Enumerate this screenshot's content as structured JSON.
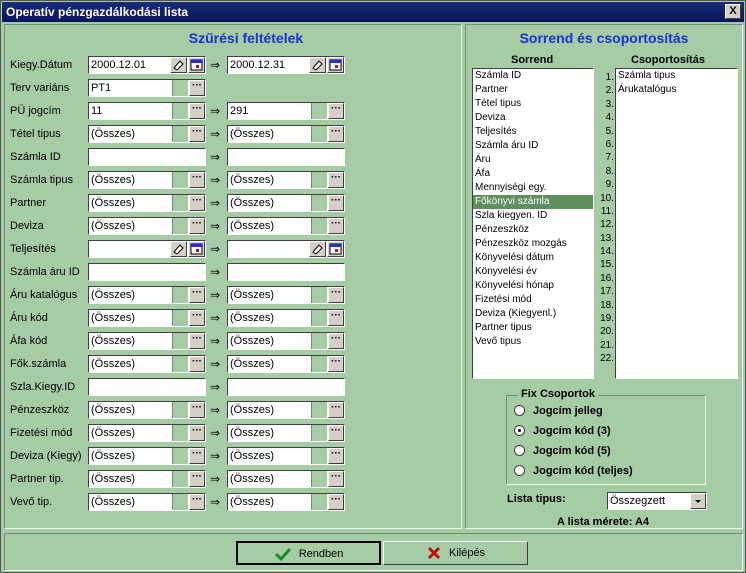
{
  "window": {
    "title": "Operatív pénzgazdálkodási lista",
    "close_label": "X"
  },
  "filters": {
    "heading": "Szűrési feltételek",
    "rows": [
      {
        "label": "Kiegy.Dátum",
        "from": "2000.12.01",
        "to": "2000.12.31"
      },
      {
        "label": "Terv variáns",
        "from": "PT1",
        "to": ""
      },
      {
        "label": "PÜ jogcím",
        "from": "11",
        "to": "291"
      },
      {
        "label": "Tétel tipus",
        "from": "(Összes)",
        "to": "(Összes)"
      },
      {
        "label": "Számla ID",
        "from": "",
        "to": ""
      },
      {
        "label": "Számla tipus",
        "from": "(Összes)",
        "to": "(Összes)"
      },
      {
        "label": "Partner",
        "from": "(Összes)",
        "to": "(Összes)"
      },
      {
        "label": "Deviza",
        "from": "(Összes)",
        "to": "(Összes)"
      },
      {
        "label": "Teljesítés",
        "from": "",
        "to": ""
      },
      {
        "label": "Számla áru ID",
        "from": "",
        "to": ""
      },
      {
        "label": "Áru katalógus",
        "from": "(Összes)",
        "to": "(Összes)"
      },
      {
        "label": "Áru kód",
        "from": "(Összes)",
        "to": "(Összes)"
      },
      {
        "label": "Áfa kód",
        "from": "(Összes)",
        "to": "(Összes)"
      },
      {
        "label": "Fők.számla",
        "from": "(Összes)",
        "to": "(Összes)"
      },
      {
        "label": "Szla.Kiegy.ID",
        "from": "",
        "to": ""
      },
      {
        "label": "Pénzeszköz",
        "from": "(Összes)",
        "to": "(Összes)"
      },
      {
        "label": "Fizetési mód",
        "from": "(Összes)",
        "to": "(Összes)"
      },
      {
        "label": "Deviza (Kiegy)",
        "from": "(Összes)",
        "to": "(Összes)"
      },
      {
        "label": "Partner tip.",
        "from": "(Összes)",
        "to": "(Összes)"
      },
      {
        "label": "Vevő tip.",
        "from": "(Összes)",
        "to": "(Összes)"
      }
    ],
    "arrow": "⇒",
    "dots": "···"
  },
  "sort": {
    "heading": "Sorrend és csoportosítás",
    "sort_title": "Sorrend",
    "group_title": "Csoportosítás",
    "sort_items": [
      "Számla ID",
      "Partner",
      "Tétel tipus",
      "Deviza",
      "Teljesítés",
      "Számla áru ID",
      "Áru",
      "Áfa",
      "Mennyiségi egy.",
      "Főkönyvi számla",
      "Szla kiegyen. ID",
      "Pénzeszköz",
      "Pénzeszköz mozgás",
      "Könyvelési dátum",
      "Könyvelési év",
      "Könyvelési hónap",
      "Fizetési mód",
      "Deviza (Kiegyenl.)",
      "Partner tipus",
      "Vevő tipus"
    ],
    "selected_index": 9,
    "numbers": [
      "1.",
      "2.",
      "3.",
      "4.",
      "5.",
      "6.",
      "7.",
      "8.",
      "9.",
      "10.",
      "11.",
      "12.",
      "13.",
      "14.",
      "15.",
      "16.",
      "17.",
      "18.",
      "19.",
      "20.",
      "21.",
      "22."
    ],
    "group_items": [
      "Számla tipus",
      "Árukatalógus"
    ]
  },
  "fix_groups": {
    "title": "Fix Csoportok",
    "options": [
      "Jogcím jelleg",
      "Jogcím kód (3)",
      "Jogcím kód (5)",
      "Jogcím kód (teljes)"
    ],
    "selected": 1
  },
  "list_type": {
    "label": "Lista tipus:",
    "value": "Összegzett"
  },
  "list_size": {
    "text": "A lista mérete:  A4"
  },
  "buttons": {
    "ok": "Rendben",
    "cancel": "Kilépés"
  },
  "colors": {
    "accent": "#1a30d8",
    "background": "#A6CCA6",
    "selection": "#5f8f5f"
  }
}
